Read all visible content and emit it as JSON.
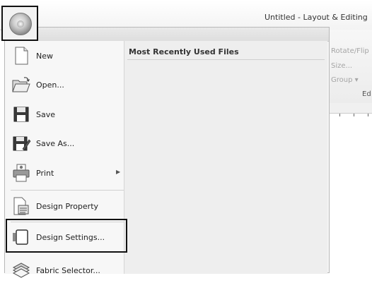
{
  "window": {
    "title": "Untitled - Layout & Editing"
  },
  "app_button": {
    "name": "application-button"
  },
  "menu": {
    "items": [
      {
        "label": "New",
        "icon": "new-document-icon",
        "has_submenu": false
      },
      {
        "label": "Open...",
        "icon": "open-folder-icon",
        "has_submenu": false
      },
      {
        "label": "Save",
        "icon": "save-disk-icon",
        "has_submenu": false
      },
      {
        "label": "Save As...",
        "icon": "save-as-icon",
        "has_submenu": false
      },
      {
        "label": "Print",
        "icon": "printer-icon",
        "has_submenu": true
      },
      {
        "label": "Design Property",
        "icon": "design-property-icon",
        "has_submenu": false
      },
      {
        "label": "Design Settings...",
        "icon": "design-settings-icon",
        "has_submenu": false
      },
      {
        "label": "Fabric Selector...",
        "icon": "fabric-selector-icon",
        "has_submenu": false
      }
    ],
    "recent_heading": "Most Recently Used Files"
  },
  "ribbon": {
    "items": [
      "Rotate/Flip",
      "Size...",
      "Group ▾"
    ],
    "group_label": "Ed"
  },
  "colors": {
    "highlight_border": "#111111",
    "menu_bg": "#f4f4f4"
  }
}
